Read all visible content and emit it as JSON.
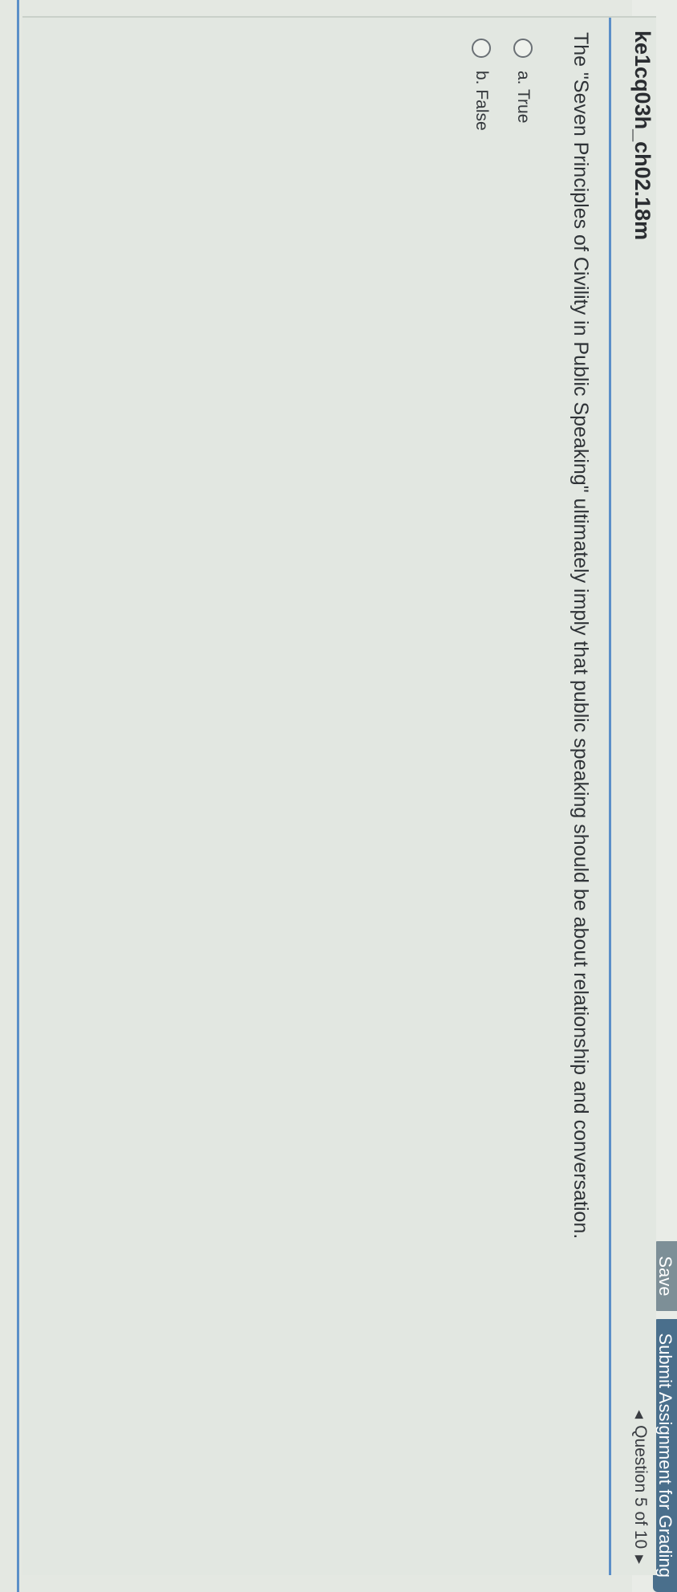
{
  "toolbar": {
    "save_label": "Save",
    "submit_label": "Submit Assignment for Grading"
  },
  "assignment": {
    "title": "ke1cq03h_ch02.18m"
  },
  "navigation": {
    "question_position": "Question 5 of 10",
    "prev_icon": "triangle-left-icon",
    "next_icon": "triangle-right-icon"
  },
  "question": {
    "text": "The \"Seven Principles of Civility in Public Speaking\" ultimately imply that public speaking should be about relationship and conversation.",
    "options": [
      {
        "label": "a. True"
      },
      {
        "label": "b. False"
      }
    ]
  },
  "colors": {
    "accent_blue": "#5b8fc8",
    "submit_button": "#4a6f8c",
    "save_button": "#7d8f97"
  }
}
